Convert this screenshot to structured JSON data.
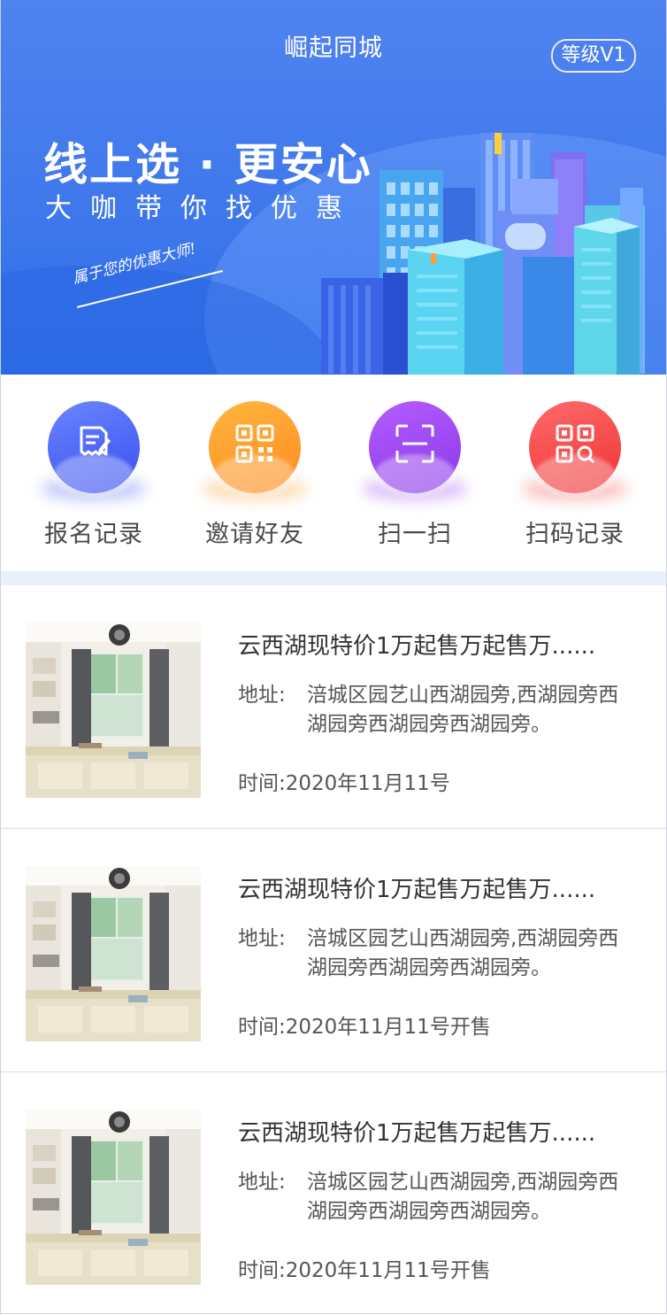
{
  "header": {
    "title": "崛起同城",
    "level_badge": "等级V1"
  },
  "banner": {
    "slogan": "线上选 · 更安心",
    "sub_slogan": "大咖带你找优惠",
    "handwriting": "属于您的优惠大师!"
  },
  "quick_nav": [
    {
      "label": "报名记录",
      "icon": "signup-record-icon",
      "color": "#4a63f2"
    },
    {
      "label": "邀请好友",
      "icon": "qrcode-icon",
      "color": "#ff9a2c"
    },
    {
      "label": "扫一扫",
      "icon": "scan-icon",
      "color": "#9b45f0"
    },
    {
      "label": "扫码记录",
      "icon": "scan-record-icon",
      "color": "#f24848"
    }
  ],
  "listings": [
    {
      "title": "云西湖现特价1万起售万起售万......",
      "address_label": "地址:",
      "address": "涪城区园艺山西湖园旁,西湖园旁西湖园旁西湖园旁西湖园旁。",
      "time_label": "时间:",
      "time": "2020年11月11号"
    },
    {
      "title": "云西湖现特价1万起售万起售万......",
      "address_label": "地址:",
      "address": "涪城区园艺山西湖园旁,西湖园旁西湖园旁西湖园旁西湖园旁。",
      "time_label": "时间:",
      "time": "2020年11月11号开售"
    },
    {
      "title": "云西湖现特价1万起售万起售万......",
      "address_label": "地址:",
      "address": "涪城区园艺山西湖园旁,西湖园旁西湖园旁西湖园旁西湖园旁。",
      "time_label": "时间:",
      "time": "2020年11月11号开售"
    }
  ],
  "colors": {
    "banner_top": "#4f83f0",
    "banner_bottom": "#2f6ee8",
    "divider": "#eaf0fb"
  }
}
